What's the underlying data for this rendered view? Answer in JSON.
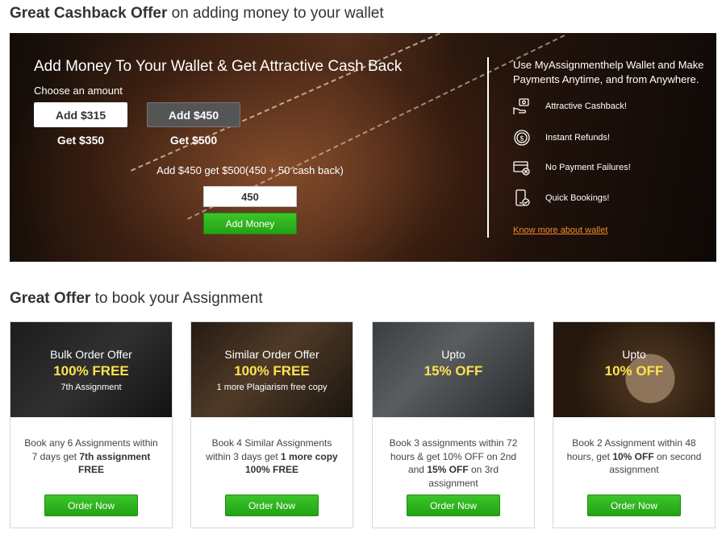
{
  "section1": {
    "title_bold": "Great Cashback Offer",
    "title_rest": " on adding money to your wallet"
  },
  "wallet": {
    "heading": "Add Money To Your Wallet & Get Attractive Cash Back",
    "choose_label": "Choose an amount",
    "options": [
      {
        "add": "Add $315",
        "get": "Get $350"
      },
      {
        "add": "Add $450",
        "get": "Get $500"
      }
    ],
    "offer_text": "Add $450 get $500(450 + 50 cash back)",
    "amount_value": "450",
    "add_button": "Add Money",
    "right_heading": "Use MyAssignmenthelp Wallet and Make Payments Anytime, and from Anywhere.",
    "features": [
      {
        "label": "Attractive Cashback!",
        "icon": "cash-hand-icon"
      },
      {
        "label": "Instant Refunds!",
        "icon": "refund-coin-icon"
      },
      {
        "label": "No Payment Failures!",
        "icon": "card-no-failure-icon"
      },
      {
        "label": "Quick Bookings!",
        "icon": "phone-check-icon"
      }
    ],
    "know_more": "Know more about wallet"
  },
  "section2": {
    "title_bold": "Great Offer",
    "title_rest": " to book your Assignment"
  },
  "cards": [
    {
      "title": "Bulk Order Offer",
      "highlight": "100% FREE",
      "sub": "7th Assignment",
      "desc_pre": "Book any 6 Assignments within 7 days get ",
      "desc_bold": "7th assignment FREE",
      "desc_post": "",
      "desc_bold2": "",
      "desc_post2": "",
      "button": "Order Now"
    },
    {
      "title": "Similar Order Offer",
      "highlight": "100% FREE",
      "sub": "1 more Plagiarism free copy",
      "desc_pre": "Book 4 Similar Assignments within 3 days get ",
      "desc_bold": "1 more copy 100% FREE",
      "desc_post": "",
      "desc_bold2": "",
      "desc_post2": "",
      "button": "Order Now"
    },
    {
      "title": "Upto",
      "highlight": "15% OFF",
      "sub": "",
      "desc_pre": "Book 3 assignments within 72 hours & get 10% OFF on 2nd and ",
      "desc_bold": "15% OFF",
      "desc_post": " on 3rd assignment",
      "desc_bold2": "",
      "desc_post2": "",
      "button": "Order Now"
    },
    {
      "title": "Upto",
      "highlight": "10% OFF",
      "sub": "",
      "desc_pre": "Book 2 Assignment within 48 hours, get ",
      "desc_bold": "10% OFF",
      "desc_post": " on second assignment",
      "desc_bold2": "",
      "desc_post2": "",
      "button": "Order Now"
    }
  ],
  "colors": {
    "green_button": "#22a315",
    "highlight_yellow": "#ffe24d",
    "link_orange": "#f58a2c"
  }
}
